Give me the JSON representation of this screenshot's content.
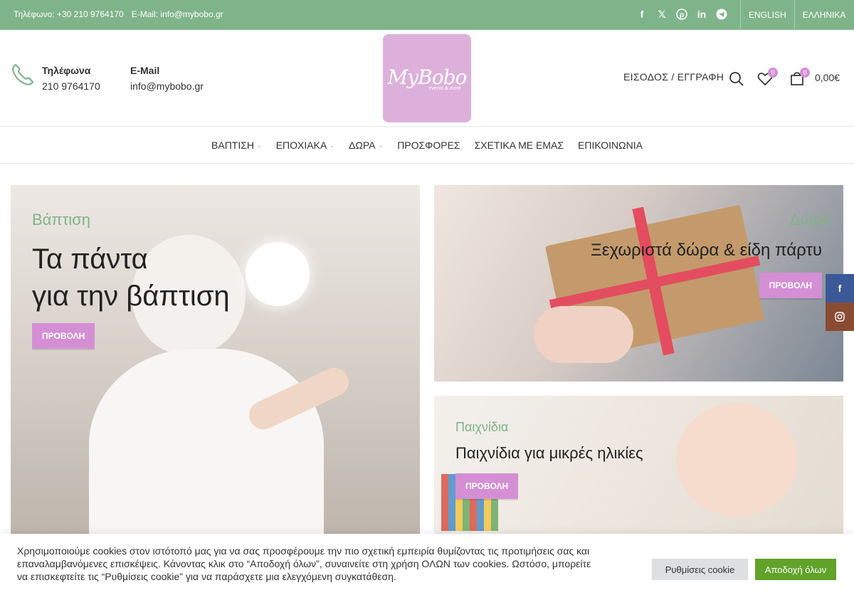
{
  "topbar": {
    "phone": "Τηλέφωνο: +30 210 9764170",
    "email": "E-Mail: info@mybobo.gr",
    "socials": [
      "facebook-icon",
      "x-icon",
      "pinterest-icon",
      "linkedin-icon",
      "telegram-icon"
    ],
    "languages": [
      "ENGLISH",
      "ΕΛΛΗΝΙΚΑ"
    ]
  },
  "header": {
    "phone_title": "Τηλέφωνα",
    "phone_value": "210 9764170",
    "email_title": "E-Mail",
    "email_value": "info@mybobo.gr",
    "logo_text": "MyBobo",
    "logo_sub": "events & more",
    "login": "ΕΙΣΟΔΟΣ / ΕΓΓΡΑΦΗ",
    "wishlist_count": "0",
    "cart_count": "0",
    "cart_total": "0,00€"
  },
  "nav": {
    "items": [
      {
        "label": "ΒΑΠΤΙΣΗ",
        "dropdown": true
      },
      {
        "label": "ΕΠΟΧΙΑΚΑ",
        "dropdown": true
      },
      {
        "label": "ΔΩΡΑ",
        "dropdown": true
      },
      {
        "label": "ΠΡΟΣΦΟΡΕΣ",
        "dropdown": false
      },
      {
        "label": "ΣΧΕΤΙΚΑ ΜΕ ΕΜΑΣ",
        "dropdown": false
      },
      {
        "label": "ΕΠΙΚΟΙΝΩΝΙΑ",
        "dropdown": false
      }
    ]
  },
  "banners": {
    "baptism": {
      "tag": "Βάπτιση",
      "title_line1": "Τα πάντα",
      "title_line2": "για την βάπτιση",
      "button": "ΠΡΟΒΟΛΗ"
    },
    "gifts": {
      "tag": "Δώρα",
      "title": "Ξεχωριστά δώρα & είδη πάρτυ",
      "button": "ΠΡΟΒΟΛΗ"
    },
    "toys": {
      "tag": "Παιχνίδια",
      "title": "Παιχνίδια για μικρές ηλικίες",
      "button": "ΠΡΟΒΟΛΗ"
    }
  },
  "float_social": [
    "facebook-icon",
    "instagram-icon"
  ],
  "cookie": {
    "text": "Χρησιμοποιούμε cookies στον ιστότοπό μας για να σας προσφέρουμε την πιο σχετική εμπειρία θυμίζοντας τις προτιμήσεις σας και επαναλαμβανόμενες επισκέψεις. Κάνοντας κλικ στο “Αποδοχή όλων”, συναινείτε στη χρήση ΟΛΩΝ των cookies. Ωστόσο, μπορείτε να επισκεφτείτε τις “Ρυθμίσεις cookie” για να παράσχετε μια ελεγχόμενη συγκατάθεση.",
    "settings": "Ρυθμίσεις cookie",
    "accept": "Αποδοχή όλων"
  },
  "colors": {
    "brand_green": "#7fb48a",
    "brand_pink": "#d48fd4",
    "accept_green": "#61a229"
  }
}
